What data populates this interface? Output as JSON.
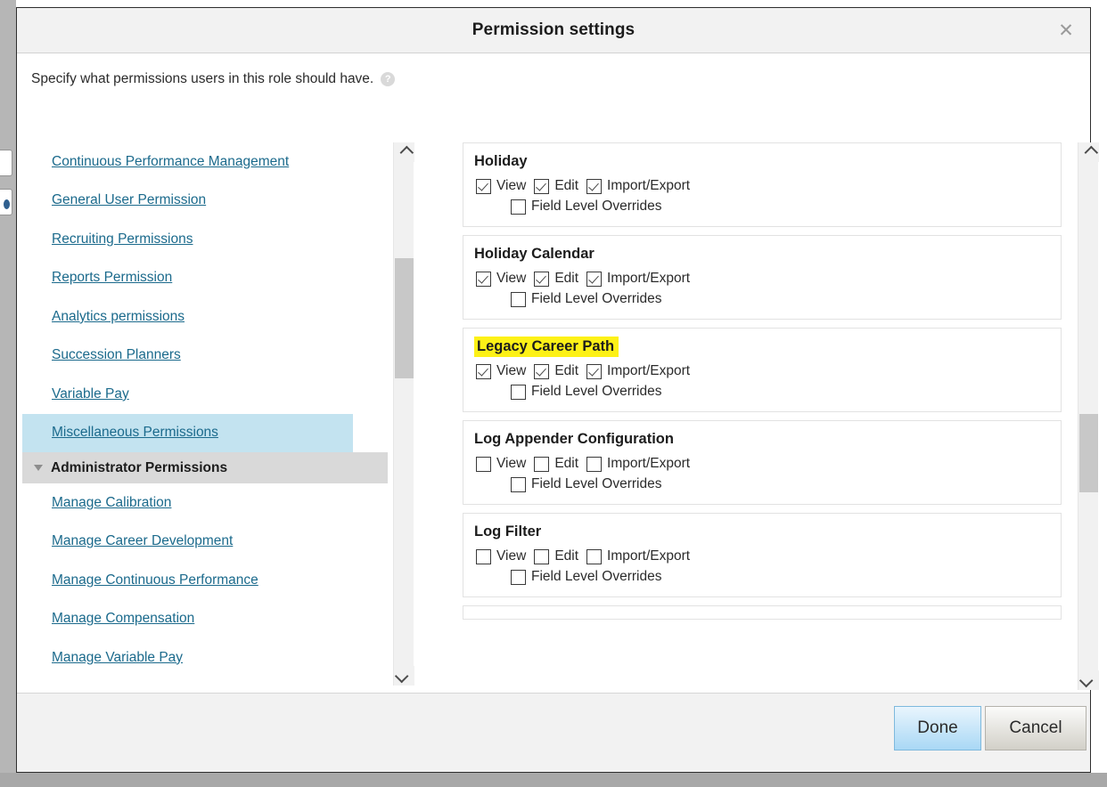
{
  "dialog": {
    "title": "Permission settings",
    "close_icon": "close-icon",
    "description": "Specify what permissions users in this role should have.",
    "help_icon_glyph": "?"
  },
  "categories": {
    "items": [
      {
        "label": "Continuous Performance Management",
        "selected": false
      },
      {
        "label": "General User Permission",
        "selected": false
      },
      {
        "label": "Recruiting Permissions",
        "selected": false
      },
      {
        "label": "Reports Permission",
        "selected": false
      },
      {
        "label": "Analytics permissions",
        "selected": false
      },
      {
        "label": "Succession Planners",
        "selected": false
      },
      {
        "label": "Variable Pay",
        "selected": false
      },
      {
        "label": "Miscellaneous Permissions",
        "selected": true
      }
    ],
    "section": {
      "label": "Administrator Permissions",
      "expanded": true
    },
    "admin_items": [
      {
        "label": "Manage Calibration"
      },
      {
        "label": "Manage Career Development"
      },
      {
        "label": "Manage Continuous Performance"
      },
      {
        "label": "Manage Compensation"
      },
      {
        "label": "Manage Variable Pay"
      }
    ]
  },
  "permission_labels": {
    "view": "View",
    "edit": "Edit",
    "import_export": "Import/Export",
    "field_level_overrides": "Field Level Overrides"
  },
  "permission_cards": [
    {
      "title": "Holiday",
      "highlighted": false,
      "view": true,
      "edit": true,
      "import_export": true,
      "field_level_overrides": false
    },
    {
      "title": "Holiday Calendar",
      "highlighted": false,
      "view": true,
      "edit": true,
      "import_export": true,
      "field_level_overrides": false
    },
    {
      "title": "Legacy Career Path",
      "highlighted": true,
      "view": true,
      "edit": true,
      "import_export": true,
      "field_level_overrides": false
    },
    {
      "title": "Log Appender Configuration",
      "highlighted": false,
      "view": false,
      "edit": false,
      "import_export": false,
      "field_level_overrides": false
    },
    {
      "title": "Log Filter",
      "highlighted": false,
      "view": false,
      "edit": false,
      "import_export": false,
      "field_level_overrides": false
    }
  ],
  "footer": {
    "done_label": "Done",
    "cancel_label": "Cancel"
  },
  "colors": {
    "link": "#1b6a8c",
    "selection": "#c3e3f0",
    "section_header": "#d9d9d9",
    "highlighter": "#fdf117",
    "primary_button": "#a9d8f5"
  }
}
